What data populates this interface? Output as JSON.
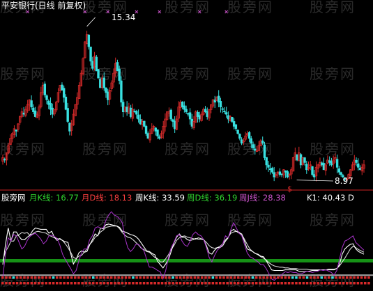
{
  "chart_title": "平安银行(日线 前复权)",
  "watermark": "股旁网",
  "colors": {
    "up": "#d92a2a",
    "down": "#38e0e0",
    "marker": "#c050c0",
    "zero_line": "#169116",
    "k": "#ffffff",
    "d": "#ffffff",
    "wk": "#aa33cc",
    "ref": "#aaaaaa",
    "sep": "#cc2222"
  },
  "price_panel": {
    "annotations": {
      "high": "15.34",
      "low": "8.97"
    },
    "ylim": [
      8.7,
      15.8
    ]
  },
  "indicator_panel": {
    "labels": {
      "name": "股旁网",
      "mk": "月K线: 16.77",
      "md": "月D线: 18.13",
      "wkk": "周K线: 33.59",
      "wkd": "周D线: 36.19",
      "wj": "周J线: 28.38",
      "k1": "K1: 40.43  D"
    },
    "ylim": [
      -20,
      110
    ]
  },
  "chart_data": [
    {
      "type": "candlestick",
      "ylim": [
        8.7,
        15.8
      ],
      "annotations": [
        {
          "label": "15.34",
          "value": 15.34
        },
        {
          "label": "8.97",
          "value": 8.97
        }
      ],
      "close": [
        9.9,
        9.8,
        10.1,
        10.4,
        10.7,
        10.9,
        11.1,
        11.0,
        11.3,
        11.6,
        11.8,
        11.7,
        11.9,
        12.1,
        12.3,
        12.0,
        11.8,
        11.6,
        11.7,
        12.0,
        12.6,
        12.9,
        12.5,
        12.3,
        12.1,
        11.9,
        11.7,
        11.9,
        12.2,
        12.6,
        12.9,
        12.7,
        12.4,
        11.9,
        11.4,
        11.0,
        11.3,
        11.7,
        12.1,
        12.4,
        12.9,
        13.4,
        14.0,
        14.7,
        15.0,
        14.5,
        13.9,
        13.6,
        14.1,
        13.5,
        13.2,
        12.8,
        13.2,
        12.8,
        12.6,
        12.3,
        12.7,
        13.0,
        13.4,
        13.8,
        13.5,
        13.1,
        12.2,
        11.8,
        12.0,
        11.8,
        12.0,
        11.6,
        11.9,
        11.8,
        11.7,
        11.5,
        11.3,
        11.4,
        11.2,
        10.9,
        10.7,
        10.9,
        11.1,
        11.2,
        11.0,
        10.8,
        10.7,
        10.9,
        11.2,
        11.5,
        11.8,
        11.8,
        11.5,
        11.4,
        11.1,
        11.5,
        12.0,
        12.2,
        12.0,
        11.9,
        11.8,
        11.7,
        11.5,
        11.2,
        11.4,
        11.8,
        11.6,
        11.5,
        11.7,
        11.9,
        11.8,
        11.6,
        11.9,
        12.1,
        12.3,
        12.2,
        12.4,
        12.2,
        12.0,
        11.9,
        11.8,
        11.7,
        11.5,
        11.6,
        11.4,
        11.2,
        11.1,
        10.9,
        10.7,
        10.5,
        10.6,
        10.8,
        10.9,
        10.7,
        10.5,
        10.3,
        10.2,
        10.2,
        10.4,
        10.6,
        10.5,
        9.9,
        9.6,
        9.5,
        9.4,
        9.3,
        9.1,
        9.2,
        9.3,
        9.2,
        9.2,
        9.4,
        9.3,
        9.1,
        9.2,
        9.4,
        9.9,
        10.1,
        9.8,
        10.1,
        9.6,
        9.9,
        9.7,
        9.4,
        9.5,
        9.6,
        9.2,
        9.1,
        9.5,
        9.6,
        9.7,
        9.6,
        9.4,
        9.6,
        9.8,
        9.7,
        9.6,
        9.8,
        9.9,
        9.5,
        9.3,
        9.2,
        9.1,
        8.99,
        9.0,
        9.2,
        9.4,
        9.6,
        9.8,
        9.7,
        9.5,
        9.4,
        9.5,
        9.6
      ]
    },
    {
      "type": "line",
      "ylim": [
        -20,
        110
      ],
      "series": [
        {
          "name": "月K线",
          "values": [
            14,
            45,
            70,
            50,
            64,
            64,
            57,
            52,
            52,
            56,
            59,
            66,
            70,
            69,
            68,
            68,
            68,
            62,
            65,
            56,
            51,
            54,
            51,
            49,
            48,
            31,
            15,
            22,
            32,
            35,
            33,
            34,
            44,
            52,
            61,
            58,
            70,
            69,
            75,
            76,
            75,
            74,
            73,
            71,
            65,
            64,
            62,
            60,
            59,
            57,
            53,
            47,
            41,
            35,
            34,
            31,
            29,
            19,
            14,
            9,
            15,
            22,
            34,
            47,
            56,
            61,
            56,
            56,
            52,
            51,
            52,
            54,
            53,
            53,
            52,
            43,
            32,
            30,
            36,
            40,
            40,
            43,
            50,
            55,
            65,
            68,
            65,
            62,
            61,
            50,
            38,
            36,
            34,
            31,
            30,
            27,
            26,
            20,
            13,
            6,
            5,
            5,
            5,
            5,
            6,
            6,
            6,
            6,
            6,
            4,
            3,
            3,
            4,
            4,
            5,
            5,
            5,
            6,
            6,
            6,
            6,
            6,
            6,
            8,
            14,
            30,
            38,
            42,
            45,
            46,
            38,
            34,
            32,
            30
          ]
        },
        {
          "name": "月D线",
          "values": [
            20,
            34,
            41,
            50,
            50,
            58,
            60,
            63,
            62,
            63,
            59,
            61,
            64,
            65,
            64,
            63,
            62,
            59,
            57,
            55,
            54,
            53,
            51,
            46,
            40,
            33,
            25,
            23,
            27,
            28,
            33,
            38,
            45,
            49,
            56,
            59,
            64,
            67,
            71,
            72,
            73,
            73,
            73,
            69,
            63,
            59,
            56,
            55,
            52,
            48,
            44,
            39,
            37,
            34,
            33,
            29,
            25,
            23,
            18,
            18,
            23,
            29,
            37,
            43,
            51,
            55,
            57,
            58,
            56,
            55,
            54,
            53,
            55,
            54,
            52,
            48,
            43,
            40,
            39,
            40,
            42,
            46,
            52,
            56,
            62,
            64,
            65,
            64,
            60,
            53,
            45,
            38,
            34,
            31,
            29,
            26,
            24,
            21,
            17,
            14,
            12,
            11,
            10,
            10,
            9,
            9,
            8,
            8,
            8,
            7,
            7,
            7,
            7,
            6,
            6,
            6,
            6,
            6,
            6,
            6,
            7,
            7,
            7,
            8,
            12,
            18,
            24,
            31,
            38,
            42,
            40,
            37,
            35,
            33
          ]
        },
        {
          "name": "周J线",
          "values": [
            -5,
            30,
            55,
            50,
            60,
            58,
            48,
            38,
            42,
            51,
            57,
            60,
            62,
            58,
            53,
            46,
            50,
            58,
            59,
            57,
            54,
            44,
            30,
            22,
            15,
            8,
            0,
            5,
            20,
            32,
            38,
            38,
            52,
            58,
            70,
            72,
            70,
            70,
            82,
            90,
            95,
            90,
            88,
            84,
            78,
            55,
            40,
            34,
            38,
            45,
            45,
            40,
            35,
            22,
            10,
            10,
            8,
            5,
            3,
            -8,
            5,
            25,
            40,
            48,
            58,
            60,
            50,
            44,
            42,
            50,
            60,
            64,
            60,
            58,
            52,
            40,
            25,
            18,
            28,
            36,
            40,
            46,
            58,
            55,
            68,
            78,
            70,
            62,
            58,
            45,
            32,
            26,
            24,
            21,
            18,
            14,
            14,
            8,
            0,
            -8,
            -10,
            -6,
            -4,
            0,
            3,
            2,
            3,
            2,
            2,
            0,
            0,
            2,
            4,
            3,
            2,
            3,
            4,
            6,
            5,
            6,
            4,
            2,
            -2,
            5,
            22,
            40,
            50,
            52,
            55,
            58,
            48,
            44,
            40,
            36
          ]
        },
        {
          "name": "参考线",
          "values": [
            0,
            0,
            0,
            0,
            0,
            0,
            0,
            0,
            0,
            0,
            0,
            0,
            0,
            0,
            0,
            0,
            0,
            0,
            0,
            0,
            0,
            0,
            0,
            0,
            0,
            0,
            0,
            0,
            0,
            0,
            0,
            0,
            0,
            0,
            0,
            0,
            0,
            0,
            0,
            0,
            0,
            0,
            0,
            0,
            0,
            0,
            0,
            0,
            0,
            0,
            0,
            0,
            0,
            0,
            0,
            0,
            0,
            0,
            0,
            0,
            0,
            0,
            0,
            0,
            0,
            0,
            0,
            0,
            0,
            0,
            0,
            0,
            0,
            0,
            0,
            0,
            0,
            0,
            0,
            0,
            0,
            0,
            0,
            0,
            0,
            0,
            0,
            0,
            0,
            0,
            0,
            0,
            0,
            0,
            0,
            0,
            0,
            0,
            0,
            0,
            0,
            0,
            0,
            0,
            0,
            0,
            0,
            0,
            0,
            0,
            0,
            0,
            0,
            0,
            0,
            0,
            0,
            0,
            0,
            0,
            0,
            0,
            0,
            0,
            0,
            0,
            0,
            0,
            0,
            0,
            0,
            0,
            0,
            0
          ]
        }
      ],
      "ref_line": 20
    }
  ]
}
